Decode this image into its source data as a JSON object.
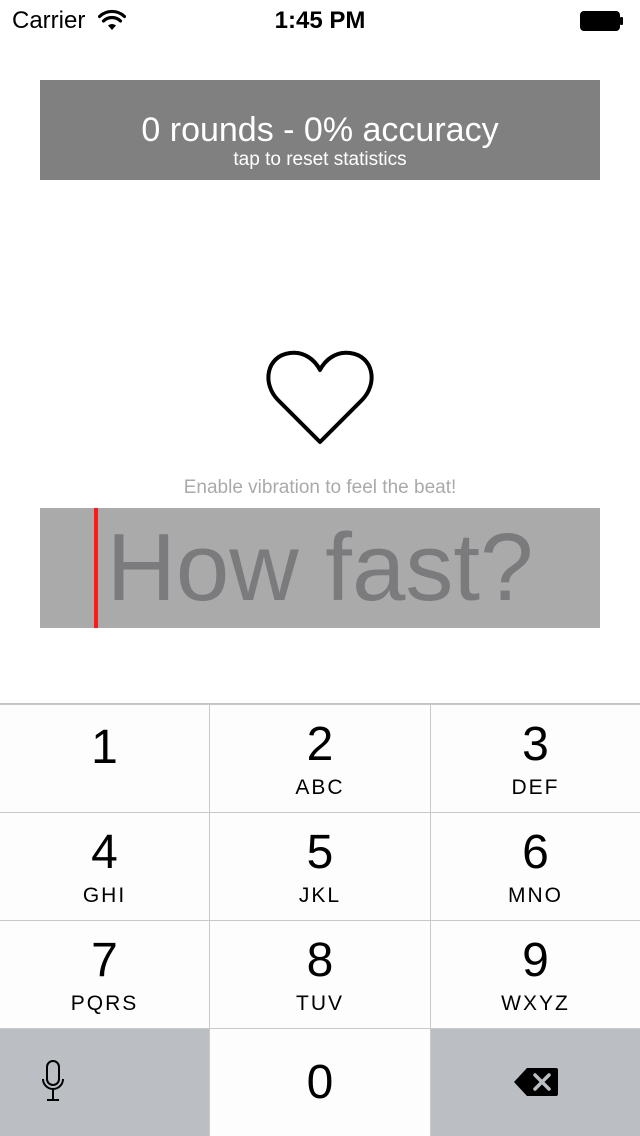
{
  "status_bar": {
    "carrier": "Carrier",
    "time": "1:45 PM",
    "icons": [
      "wifi-icon",
      "battery-icon"
    ]
  },
  "stats": {
    "title": "0 rounds - 0% accuracy",
    "subtitle": "tap to reset statistics"
  },
  "heart": {
    "icon": "heart-icon"
  },
  "hint": "Enable vibration to feel the beat!",
  "bpm_input": {
    "value": "",
    "placeholder": "How fast?"
  },
  "keypad": {
    "keys": [
      {
        "digit": "1",
        "letters": ""
      },
      {
        "digit": "2",
        "letters": "ABC"
      },
      {
        "digit": "3",
        "letters": "DEF"
      },
      {
        "digit": "4",
        "letters": "GHI"
      },
      {
        "digit": "5",
        "letters": "JKL"
      },
      {
        "digit": "6",
        "letters": "MNO"
      },
      {
        "digit": "7",
        "letters": "PQRS"
      },
      {
        "digit": "8",
        "letters": "TUV"
      },
      {
        "digit": "9",
        "letters": "WXYZ"
      },
      {
        "digit": "0",
        "letters": ""
      }
    ],
    "mic_icon": "microphone-icon",
    "delete_icon": "backspace-icon"
  },
  "colors": {
    "stats_background": "#808080",
    "input_background": "#aaaaaa",
    "caret": "#ff1a1a",
    "keypad_dark_key": "#bbbec3"
  }
}
